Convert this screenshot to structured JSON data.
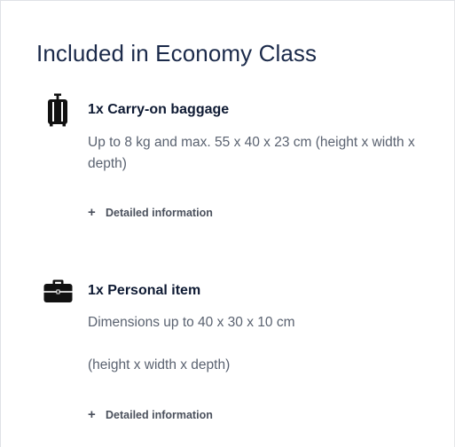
{
  "title": "Included in Economy Class",
  "items": [
    {
      "icon": "suitcase-icon",
      "title": "1x Carry-on baggage",
      "description": "Up to 8 kg and max. 55 x 40 x 23 cm (height x width x depth)",
      "detail_label": "Detailed information"
    },
    {
      "icon": "briefcase-icon",
      "title": "1x Personal item",
      "description_line1": "Dimensions up to 40 x 30 x 10 cm",
      "description_line2": "(height x width x depth)",
      "detail_label": "Detailed information"
    }
  ],
  "colors": {
    "heading": "#1b2a4a",
    "item_title": "#0e1a33",
    "body_text": "#5a6270",
    "link": "#4a505c",
    "icon": "#111111"
  }
}
